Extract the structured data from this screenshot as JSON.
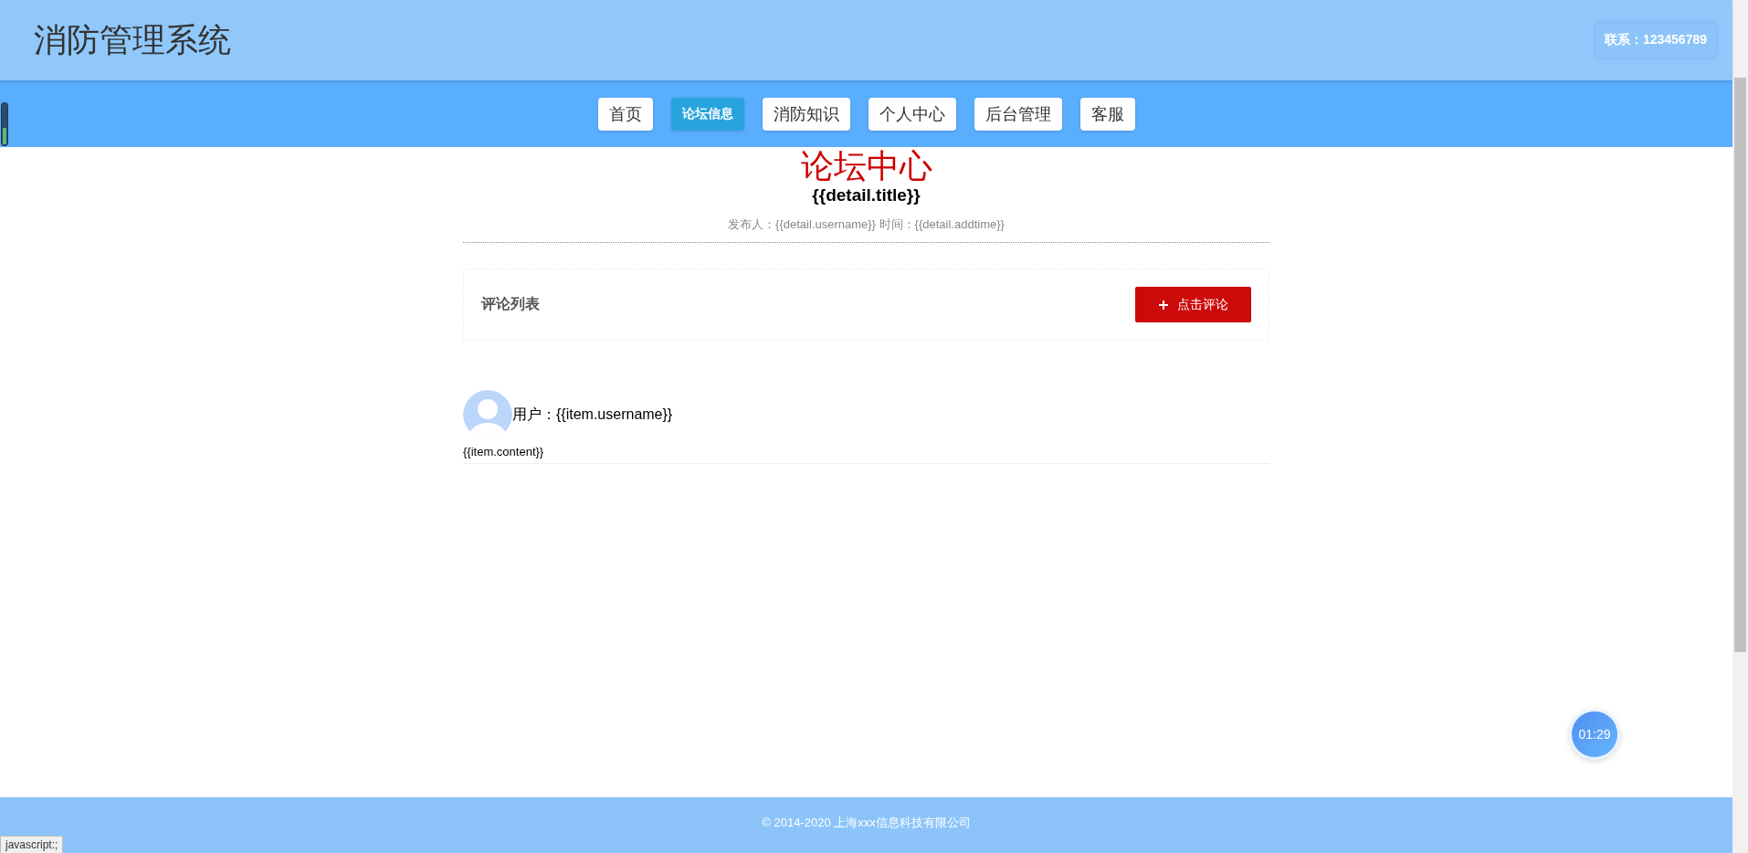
{
  "header": {
    "title": "消防管理系统",
    "contact": "联系：123456789"
  },
  "nav": [
    {
      "label": "首页",
      "selected": false
    },
    {
      "label": "论坛信息",
      "selected": true
    },
    {
      "label": "消防知识",
      "selected": false
    },
    {
      "label": "个人中心",
      "selected": false
    },
    {
      "label": "后台管理",
      "selected": false
    },
    {
      "label": "客服",
      "selected": false
    }
  ],
  "page_heading": "论坛中心",
  "post": {
    "title": "{{detail.title}}",
    "meta": "发布人：{{detail.username}} 时间：{{detail.addtime}}"
  },
  "comments": {
    "heading": "评论列表",
    "button": "点击评论",
    "items": [
      {
        "user": "用户：{{item.username}}",
        "content": "{{item.content}}"
      }
    ]
  },
  "timer": "01:29",
  "footer": "© 2014-2020 上海xxx信息科技有限公司",
  "status_bar": "javascript:;"
}
